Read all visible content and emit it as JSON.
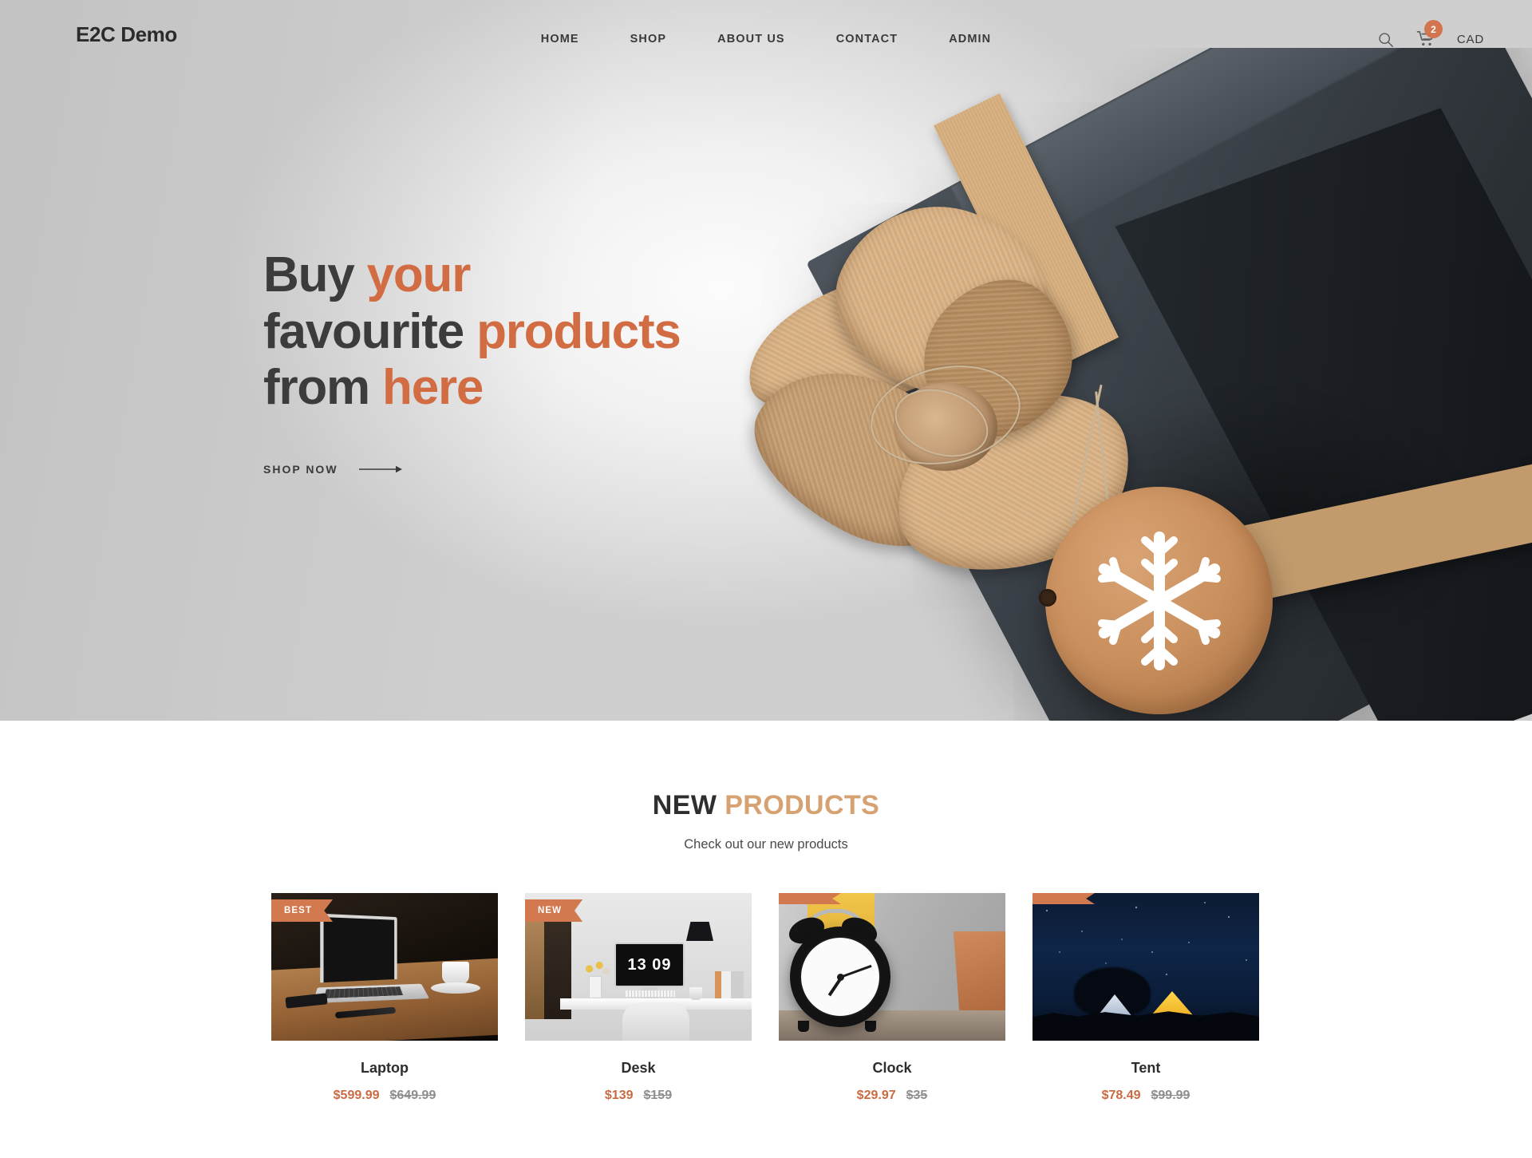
{
  "header": {
    "logo": "E2C Demo",
    "nav": [
      {
        "label": "HOME"
      },
      {
        "label": "SHOP"
      },
      {
        "label": "ABOUT US"
      },
      {
        "label": "CONTACT"
      },
      {
        "label": "ADMIN"
      }
    ],
    "search_icon": "search-icon",
    "cart_icon": "cart-icon",
    "cart_count": "2",
    "currency": "CAD"
  },
  "hero": {
    "headline": {
      "line1_plain": "Buy ",
      "line1_accent": "your",
      "line2_plain": "favourite ",
      "line2_accent": "products",
      "line3_plain": "from ",
      "line3_accent": "here"
    },
    "cta_label": "SHOP NOW",
    "cta_arrow": "arrow-right-icon",
    "image_alt": "gift-box-with-burlap-bow-and-snowflake-tag"
  },
  "products_section": {
    "title_plain": "NEW",
    "title_accent": "PRODUCTS",
    "subtitle": "Check out our new products",
    "items": [
      {
        "name": "Laptop",
        "badge": "BEST",
        "sale_price": "$599.99",
        "original_price": "$649.99",
        "image_alt": "silver-laptop-on-wooden-table-with-coffee"
      },
      {
        "name": "Desk",
        "badge": "NEW",
        "sale_price": "$139",
        "original_price": "$159",
        "image_alt": "white-desk-with-monitor-showing-13-09"
      },
      {
        "name": "Clock",
        "badge": "",
        "sale_price": "$29.97",
        "original_price": "$35",
        "image_alt": "black-twin-bell-alarm-clock"
      },
      {
        "name": "Tent",
        "badge": "",
        "sale_price": "$78.49",
        "original_price": "$99.99",
        "image_alt": "glowing-tents-under-starry-night-sky"
      }
    ],
    "desk_monitor_time": "13 09"
  },
  "colors": {
    "accent_orange": "#d26c42",
    "badge_orange": "#d2794f",
    "title_tan": "#d6a272",
    "text_dark": "#2e2e2e",
    "price_muted": "#8e8e8e"
  }
}
